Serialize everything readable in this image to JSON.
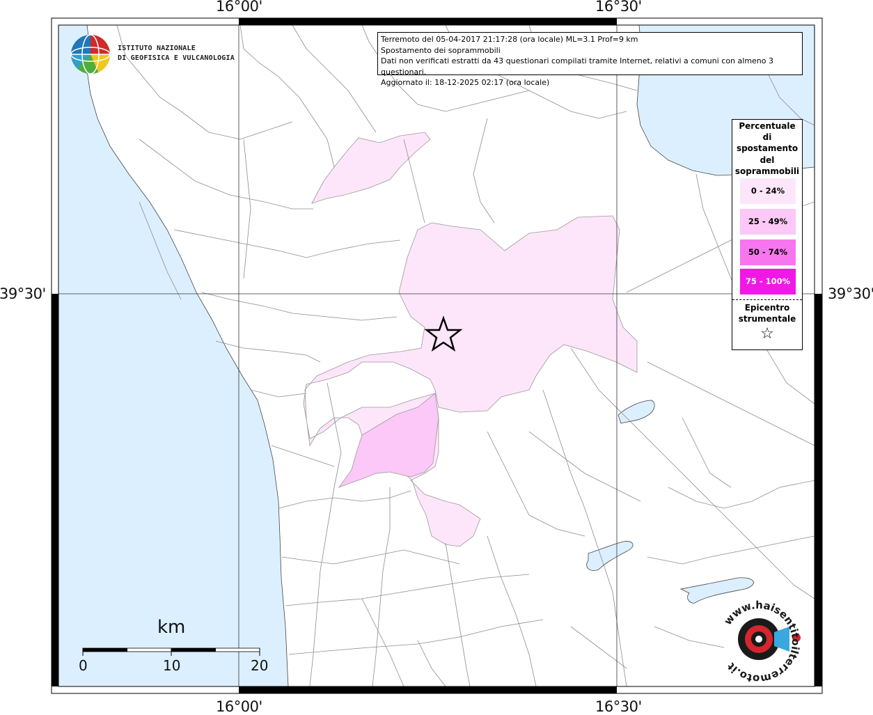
{
  "map": {
    "graticule": {
      "lon_labels": [
        "16°00'",
        "16°30'"
      ],
      "lat_labels": [
        "39°30'"
      ]
    },
    "info": {
      "line1": "Terremoto del 05-04-2017 21:17:28 (ora locale) ML=3.1 Prof=9 km",
      "line2": "Spostamento dei soprammobili",
      "line3": "Dati non verificati estratti da 43 questionari compilati tramite Internet, relativi a comuni con almeno 3 questionari.",
      "line4": "Aggiornato il: 18-12-2025 02:17 (ora locale)"
    },
    "legend": {
      "title_lines": [
        "Percentuale",
        "di",
        "spostamento",
        "del",
        "soprammobili"
      ],
      "classes": [
        {
          "label": "0 - 24%",
          "color": "#fde6fa"
        },
        {
          "label": "25 - 49%",
          "color": "#fbc8f7"
        },
        {
          "label": "50 - 74%",
          "color": "#f776f0"
        },
        {
          "label": "75 - 100%",
          "color": "#f018e6"
        }
      ],
      "epicenter_lines": [
        "Epicentro",
        "strumentale"
      ],
      "epicenter_symbol": "☆"
    },
    "scale": {
      "title": "km",
      "ticks": [
        "0",
        "10",
        "20"
      ]
    },
    "logo": {
      "line1": "ISTITUTO NAZIONALE",
      "line2": "DI GEOFISICA E VULCANOLOGIA"
    },
    "watermark": {
      "text": "www.haisentitoilterremoto.it",
      "colors": {
        "ring": "#1a1a1a",
        "accent": "#d4262c",
        "blue": "#3aa7e0"
      }
    },
    "colors": {
      "sea": "#dcefff",
      "land": "#ffffff",
      "border": "#9a9a9a"
    }
  }
}
